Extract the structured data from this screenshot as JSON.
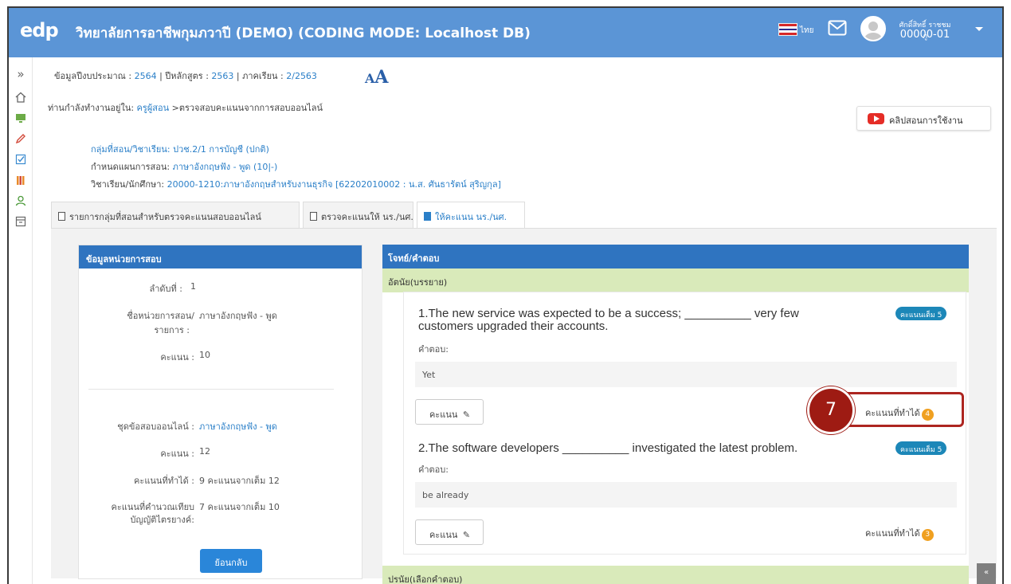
{
  "header": {
    "logo": "edp",
    "title": "วิทยาลัยการอาชีพกุมภวาปี (DEMO) (CODING MODE: Localhost DB)",
    "language": "ไทย",
    "user_name": "ศักดิ์สิทธิ์ ราชชมภู",
    "user_id": "00000-01"
  },
  "sidebar": {
    "icons": [
      "chevrons-right-icon",
      "home-icon",
      "monitor-icon",
      "pencil-icon",
      "checkbox-icon",
      "books-icon",
      "user-icon",
      "archive-icon"
    ]
  },
  "info": {
    "budget_label": "ข้อมูลปีงบประมาณ :",
    "budget_value": "2564",
    "curriculum_label": "ปีหลักสูตร :",
    "curriculum_value": "2563",
    "semester_label": "ภาคเรียน :",
    "semester_value": "2/2563",
    "font_size_small": "A",
    "font_size_large": "A"
  },
  "breadcrumb": {
    "prefix": "ท่านกำลังทำงานอยู่ใน:",
    "role": "ครูผู้สอน",
    "current": ">ตรวจสอบคะแนนจากการสอบออนไลน์"
  },
  "tutorial_button": "คลิปสอนการใช้งาน",
  "meta": {
    "group_label": "กลุ่มที่สอน/วิชาเรียน:",
    "group_value": "ปวช.2/1 การบัญชี (ปกติ)",
    "plan_label": "กำหนดแผนการสอน:",
    "plan_value": "ภาษาอังกฤษฟัง - พูด (10|-)",
    "subject_label": "วิชาเรียน/นักศึกษา:",
    "subject_value": "20000-1210:ภาษาอังกฤษสำหรับงานธุรกิจ [62202010002 : น.ส. ศันธารัตน์ สุริญกุล]"
  },
  "tabs": [
    {
      "label": "รายการกลุ่มที่สอนสำหรับตรวจคะแนนสอบออนไลน์",
      "active": false
    },
    {
      "label": "ตรวจคะแนนให้ นร./นศ.",
      "active": false
    },
    {
      "label": "ให้คะแนน นร./นศ.",
      "active": true
    }
  ],
  "left_panel": {
    "title": "ข้อมูลหน่วยการสอบ",
    "order_label": "ลำดับที่ :",
    "order_value": "1",
    "unit_label_1": "ชื่อหน่วยการสอน/",
    "unit_label_2": "รายการ :",
    "unit_value": "ภาษาอังกฤษฟัง - พูด",
    "score_label": "คะแนน :",
    "score_value": "10",
    "set_label": "ชุดข้อสอบออนไลน์ :",
    "set_value": "ภาษาอังกฤษฟัง - พูด",
    "set_score_label": "คะแนน :",
    "set_score_value": "12",
    "earned_label": "คะแนนที่ทำได้ :",
    "earned_value": "9 คะแนนจากเต็ม 12",
    "calc_label_1": "คะแนนที่คำนวณเทียบ",
    "calc_label_2": "บัญญัติไตรยางค์:",
    "calc_value": "7 คะแนนจากเต็ม 10",
    "back_button": "ย้อนกลับ"
  },
  "right_panel": {
    "title": "โจทย์/คำตอบ",
    "section_subjective": "อัตนัย(บรรยาย)",
    "section_objective": "ปรนัย(เลือกคำตอบ)",
    "questions": [
      {
        "line1": "1.The new service was expected to be a success; __________ very few",
        "line2": "customers upgraded their accounts.",
        "badge": "คะแนนเต็ม 5",
        "answer_label": "คำตอบ:",
        "answer": "Yet",
        "score_button": "คะแนน",
        "earned_label": "คะแนนที่ทำได้",
        "earned": "4"
      },
      {
        "line1": "2.The software developers __________ investigated the latest problem.",
        "badge": "คะแนนเต็ม 5",
        "answer_label": "คำตอบ:",
        "answer": "be already",
        "score_button": "คะแนน",
        "earned_label": "คะแนนที่ทำได้",
        "earned": "3"
      }
    ]
  },
  "callout": {
    "number": "7"
  },
  "scroll_top": "«",
  "colors": {
    "header_bg": "#5b95d6",
    "panel_header": "#2f74c0",
    "section_bar": "#d9eaba",
    "badge": "#1c87b8",
    "score_pill": "#f0a020",
    "callout": "#9e1b13"
  }
}
